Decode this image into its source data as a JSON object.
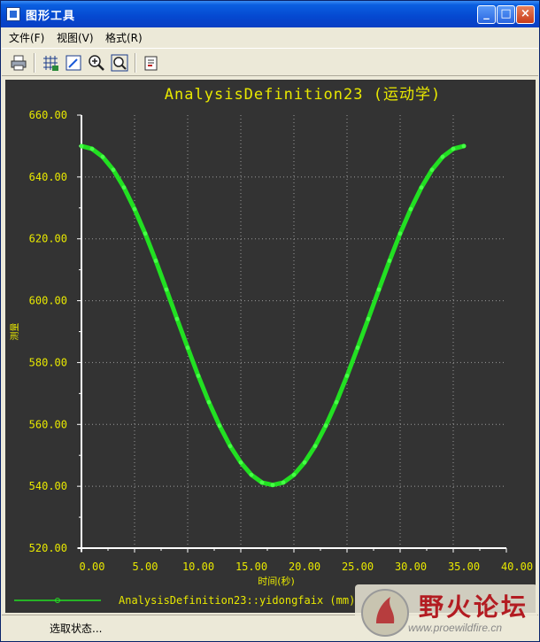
{
  "window": {
    "title": "图形工具"
  },
  "menu": [
    {
      "label": "文件(F)"
    },
    {
      "label": "视图(V)"
    },
    {
      "label": "格式(R)"
    }
  ],
  "toolbar": {
    "icons": [
      "print-icon",
      "grid-icon",
      "edit-icon",
      "zoom-in-icon",
      "zoom-fit-icon",
      "export-icon"
    ]
  },
  "chart_data": {
    "type": "line",
    "title": "AnalysisDefinition23 (运动学)",
    "xlabel": "时间(秒)",
    "ylabel": "测量",
    "xlim": [
      0,
      40
    ],
    "ylim": [
      520,
      660
    ],
    "x_ticks": [
      "0.00",
      "5.00",
      "10.00",
      "15.00",
      "20.00",
      "25.00",
      "30.00",
      "35.00",
      "40.00"
    ],
    "y_ticks": [
      "520.00",
      "540.00",
      "560.00",
      "580.00",
      "600.00",
      "620.00",
      "640.00",
      "660.00"
    ],
    "grid": true,
    "series": [
      {
        "name": "AnalysisDefinition23::yidongfaix (mm)",
        "color": "#22e022",
        "x": [
          0,
          1,
          2,
          3,
          4,
          5,
          6,
          7,
          8,
          9,
          10,
          11,
          12,
          13,
          14,
          15,
          16,
          17,
          18,
          19,
          20,
          21,
          22,
          23,
          24,
          25,
          26,
          27,
          28,
          29,
          30,
          31,
          32,
          33,
          34,
          35,
          36
        ],
        "y": [
          650,
          649.1,
          646.5,
          642.3,
          636.6,
          629.6,
          621.7,
          612.9,
          603.6,
          594.1,
          584.8,
          575.7,
          567.2,
          559.6,
          553.0,
          547.7,
          543.7,
          541.2,
          540.4,
          541.2,
          543.7,
          547.7,
          553.0,
          559.6,
          567.2,
          575.7,
          584.8,
          594.1,
          603.6,
          612.9,
          621.7,
          629.6,
          636.6,
          642.3,
          646.5,
          649.1,
          650
        ]
      }
    ]
  },
  "status": {
    "text": "选取状态..."
  },
  "colors": {
    "plot_bg": "#333333",
    "text": "#e8e800",
    "curve": "#22e022",
    "axis": "#ffffff",
    "grid": "#9a9a9a"
  },
  "watermark": {
    "text": "野火论坛",
    "url": "www.proewildfire.cn"
  }
}
